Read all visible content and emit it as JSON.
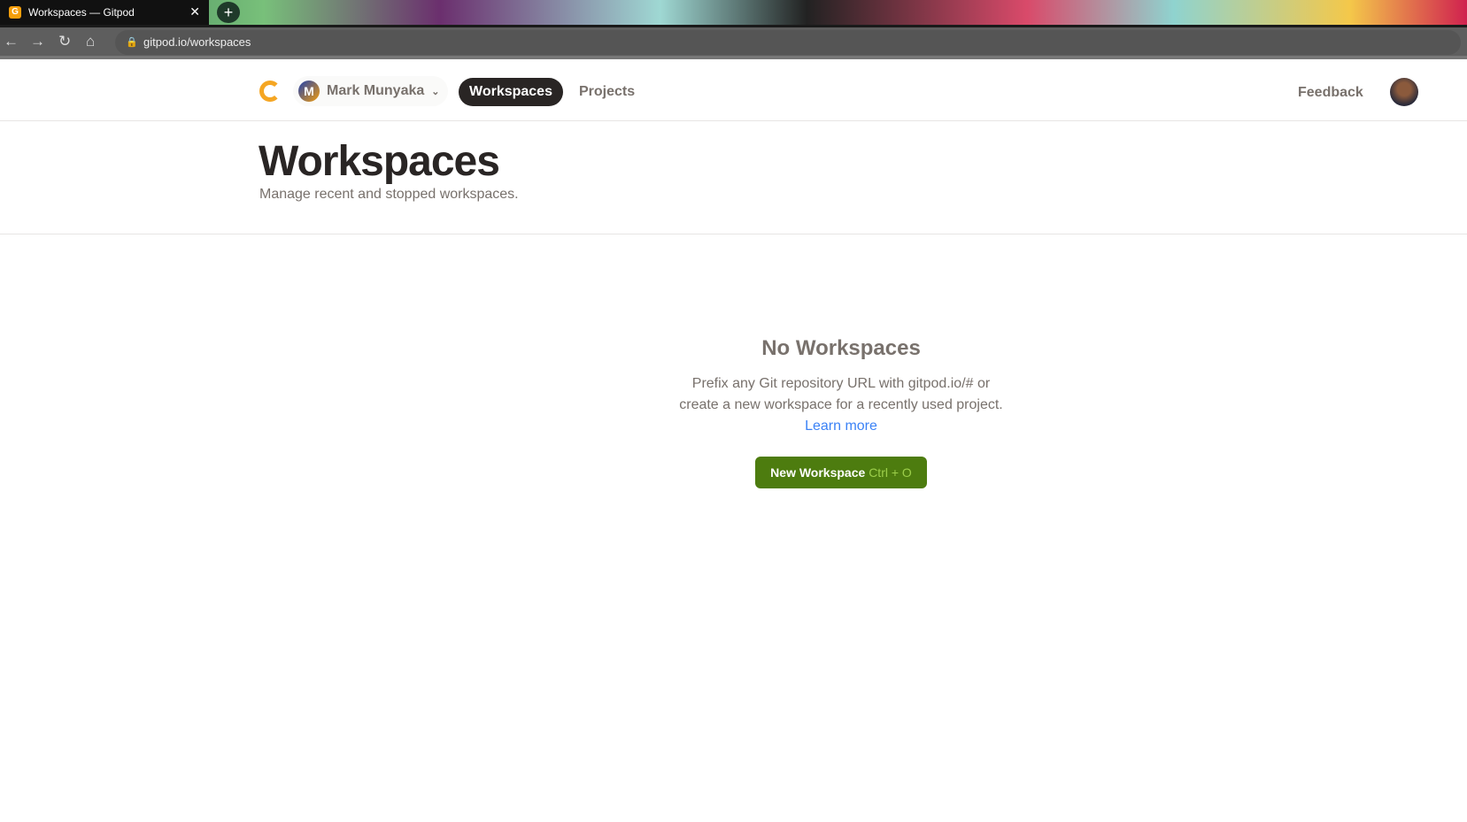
{
  "browser": {
    "tab_title": "Workspaces — Gitpod",
    "url": "gitpod.io/workspaces"
  },
  "header": {
    "user_name": "Mark Munyaka",
    "user_initial": "M",
    "nav": [
      "Workspaces",
      "Projects"
    ],
    "feedback": "Feedback"
  },
  "page": {
    "title": "Workspaces",
    "subtitle": "Manage recent and stopped workspaces."
  },
  "empty": {
    "title": "No Workspaces",
    "text": "Prefix any Git repository URL with gitpod.io/# or create a new workspace for a recently used project.",
    "link": "Learn more",
    "button": "New Workspace",
    "shortcut": "Ctrl + O"
  },
  "colors": {
    "primary": "#4d7c0f",
    "link": "#3b82f6",
    "brand": "#f5a623"
  }
}
